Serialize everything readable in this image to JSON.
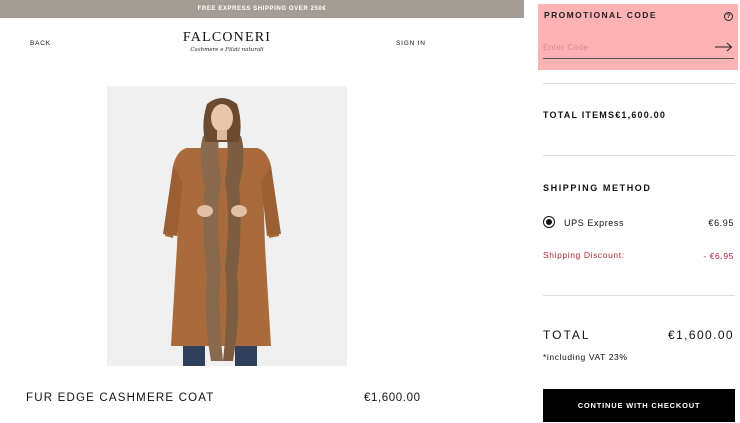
{
  "banner": {
    "text": "FREE EXPRESS SHIPPING OVER 250€"
  },
  "header": {
    "back_label": "BACK",
    "brand": "FALCONERI",
    "tagline": "Cashmere e Filati naturali",
    "sign_in_label": "SIGN IN"
  },
  "product": {
    "name": "FUR EDGE CASHMERE COAT",
    "price": "€1,600.00",
    "image_icon": "product-photo"
  },
  "promo": {
    "title": "PROMOTIONAL CODE",
    "placeholder": "Enter Code",
    "value": "",
    "help_symbol": "?",
    "help_icon": "question-circle-icon",
    "submit_icon": "arrow-right-icon"
  },
  "summary": {
    "total_items_label": "TOTAL ITEMS",
    "total_items_value": "€1,600.00"
  },
  "shipping": {
    "heading": "SHIPPING METHOD",
    "methods": [
      {
        "label": "UPS Express",
        "price": "€6.95",
        "selected": true
      }
    ],
    "discount_label": "Shipping Discount:",
    "discount_value": "- €6.95"
  },
  "total": {
    "label": "TOTAL",
    "value": "€1,600.00",
    "vat_note": "*including VAT 23%"
  },
  "checkout": {
    "label": "CONTINUE WITH CHECKOUT"
  },
  "colors": {
    "banner_bg": "#a39c95",
    "promo_highlight": "#fdb3b3",
    "discount_red": "#b3243c",
    "button_bg": "#000000"
  }
}
